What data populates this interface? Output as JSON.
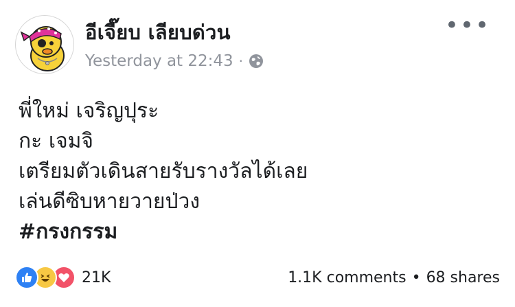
{
  "post": {
    "author_name": "อีเจี๊ยบ เลียบด่วน",
    "timestamp": "Yesterday at 22:43",
    "separator": "·",
    "privacy_icon": "globe-icon",
    "more_label": "•••",
    "lines": [
      "พี่ใหม่ เจริญปุระ",
      "กะ เจมจิ",
      "เตรียมตัวเดินสายรับรางวัลได้เลย",
      "เล่นดีซิบหายวายป่วง"
    ],
    "hashtag": "#กรงกรรม"
  },
  "footer": {
    "reaction_icons": [
      "like-icon",
      "haha-icon",
      "love-icon"
    ],
    "reaction_count": "21K",
    "comments": "1.1K comments",
    "dot": "•",
    "shares": "68 shares"
  },
  "colors": {
    "like": "#2e81f4",
    "haha": "#f7c844",
    "love": "#f25268",
    "meta_text": "#90949c",
    "avatar_scarf": "#e0329a",
    "avatar_face": "#f7d23a"
  }
}
